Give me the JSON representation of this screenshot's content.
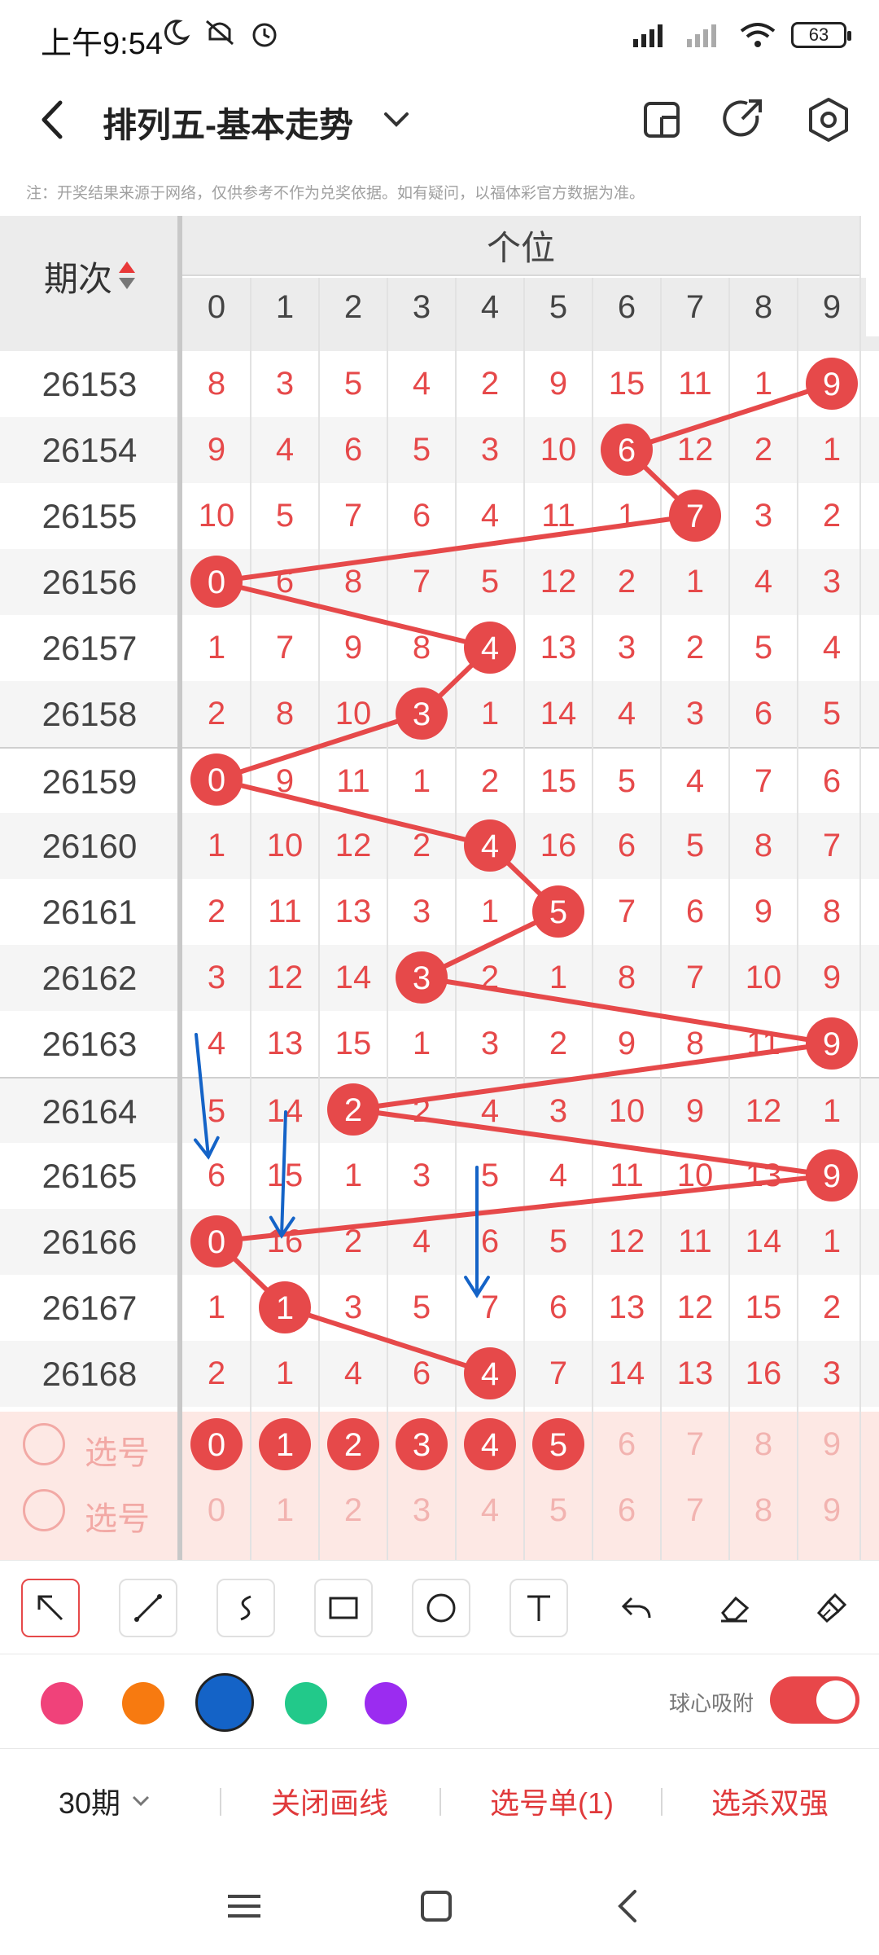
{
  "status": {
    "time": "上午9:54",
    "battery": "63"
  },
  "header": {
    "title": "排列五-基本走势"
  },
  "notice": "注：开奖结果来源于网络，仅供参考不作为兑奖依据。如有疑问，以福体彩官方数据为准。",
  "table": {
    "period_header": "期次",
    "group_header": "个位",
    "digits": [
      "0",
      "1",
      "2",
      "3",
      "4",
      "5",
      "6",
      "7",
      "8",
      "9"
    ],
    "rows": [
      {
        "period": "26153",
        "cells": [
          "8",
          "3",
          "5",
          "4",
          "2",
          "9",
          "15",
          "11",
          "1",
          "9"
        ],
        "hit": 9
      },
      {
        "period": "26154",
        "cells": [
          "9",
          "4",
          "6",
          "5",
          "3",
          "10",
          "6",
          "12",
          "2",
          "1"
        ],
        "hit": 6
      },
      {
        "period": "26155",
        "cells": [
          "10",
          "5",
          "7",
          "6",
          "4",
          "11",
          "1",
          "7",
          "3",
          "2"
        ],
        "hit": 7
      },
      {
        "period": "26156",
        "cells": [
          "0",
          "6",
          "8",
          "7",
          "5",
          "12",
          "2",
          "1",
          "4",
          "3"
        ],
        "hit": 0
      },
      {
        "period": "26157",
        "cells": [
          "1",
          "7",
          "9",
          "8",
          "4",
          "13",
          "3",
          "2",
          "5",
          "4"
        ],
        "hit": 4
      },
      {
        "period": "26158",
        "cells": [
          "2",
          "8",
          "10",
          "3",
          "1",
          "14",
          "4",
          "3",
          "6",
          "5"
        ],
        "hit": 3
      },
      {
        "period": "26159",
        "cells": [
          "0",
          "9",
          "11",
          "1",
          "2",
          "15",
          "5",
          "4",
          "7",
          "6"
        ],
        "hit": 0
      },
      {
        "period": "26160",
        "cells": [
          "1",
          "10",
          "12",
          "2",
          "4",
          "16",
          "6",
          "5",
          "8",
          "7"
        ],
        "hit": 4
      },
      {
        "period": "26161",
        "cells": [
          "2",
          "11",
          "13",
          "3",
          "1",
          "5",
          "7",
          "6",
          "9",
          "8"
        ],
        "hit": 5
      },
      {
        "period": "26162",
        "cells": [
          "3",
          "12",
          "14",
          "3",
          "2",
          "1",
          "8",
          "7",
          "10",
          "9"
        ],
        "hit": 3
      },
      {
        "period": "26163",
        "cells": [
          "4",
          "13",
          "15",
          "1",
          "3",
          "2",
          "9",
          "8",
          "11",
          "9"
        ],
        "hit": 9
      },
      {
        "period": "26164",
        "cells": [
          "5",
          "14",
          "2",
          "2",
          "4",
          "3",
          "10",
          "9",
          "12",
          "1"
        ],
        "hit": 2
      },
      {
        "period": "26165",
        "cells": [
          "6",
          "15",
          "1",
          "3",
          "5",
          "4",
          "11",
          "10",
          "13",
          "9"
        ],
        "hit": 9
      },
      {
        "period": "26166",
        "cells": [
          "0",
          "16",
          "2",
          "4",
          "6",
          "5",
          "12",
          "11",
          "14",
          "1"
        ],
        "hit": 0
      },
      {
        "period": "26167",
        "cells": [
          "1",
          "1",
          "3",
          "5",
          "7",
          "6",
          "13",
          "12",
          "15",
          "2"
        ],
        "hit": 1
      },
      {
        "period": "26168",
        "cells": [
          "2",
          "1",
          "4",
          "6",
          "4",
          "7",
          "14",
          "13",
          "16",
          "3"
        ],
        "hit": 4
      }
    ],
    "pick_label": "选号",
    "pick_rows": [
      {
        "label": "选号",
        "selected": [
          "0",
          "1",
          "2",
          "3",
          "4",
          "5"
        ],
        "numbers": [
          "0",
          "1",
          "2",
          "3",
          "4",
          "5",
          "6",
          "7",
          "8",
          "9"
        ]
      },
      {
        "label": "选号",
        "selected": [],
        "numbers": [
          "0",
          "1",
          "2",
          "3",
          "4",
          "5",
          "6",
          "7",
          "8",
          "9"
        ]
      }
    ]
  },
  "drawing": {
    "tools": [
      "arrow-tool",
      "line-tool",
      "curve-tool",
      "rectangle-tool",
      "circle-tool",
      "text-tool",
      "undo-tool",
      "eraser-tool",
      "clear-tool"
    ],
    "active_tool": "arrow-tool",
    "colors": [
      "#f0427a",
      "#f77a10",
      "#1463c7",
      "#22c98a",
      "#9b2cf0"
    ],
    "selected_color": "#1463c7",
    "snap_label": "球心吸附",
    "snap_on": true
  },
  "bottom": {
    "period_select": "30期",
    "close_lines": "关闭画线",
    "pick_list": "选号单(1)",
    "kill_double": "选杀双强"
  },
  "colors": {
    "accent": "#e6494a",
    "arrow": "#1463c7"
  }
}
